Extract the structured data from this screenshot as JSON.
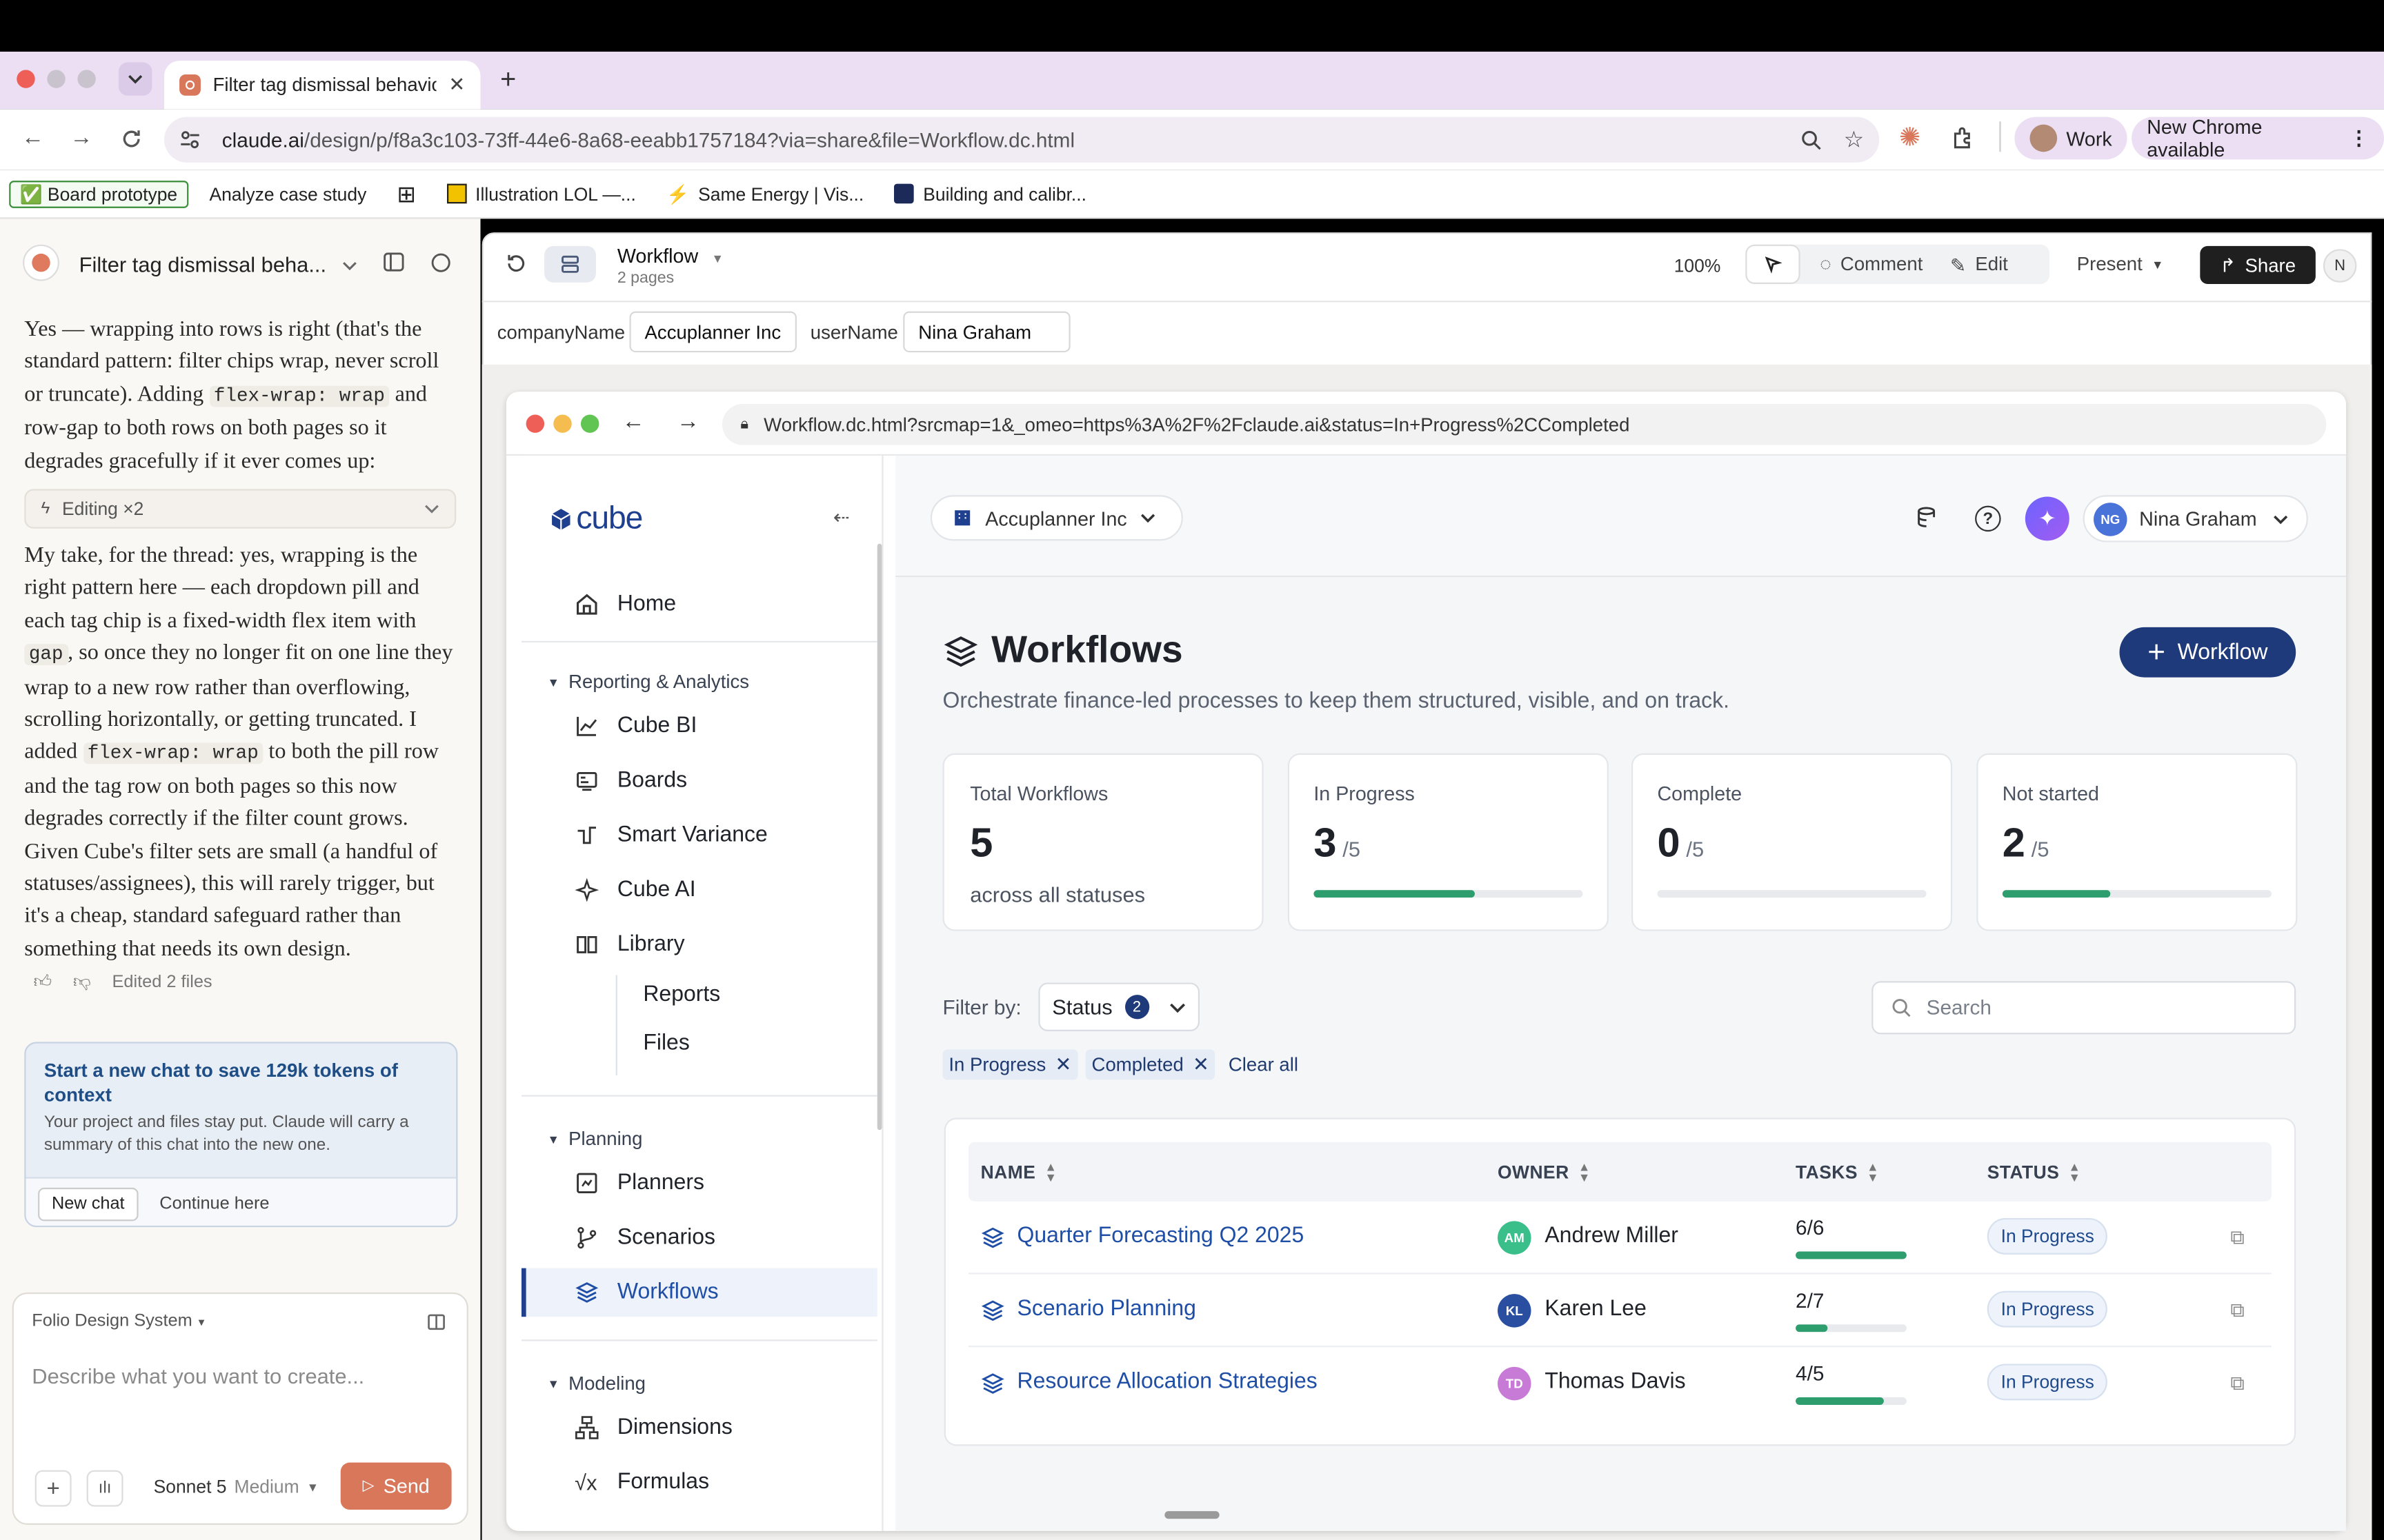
{
  "browser": {
    "tab_title": "Filter tag dismissal behavior",
    "url_host": "claude.ai",
    "url_path": "/design/p/f8a3c103-73ff-44e6-8a68-eeabb1757184?via=share&file=Workflow.dc.html",
    "profile_label": "Work",
    "update_label": "New Chrome available",
    "bookmarks": [
      "✅ Board prototype",
      "Analyze case study",
      "Illustration LOL —...",
      "Same Energy | Vis...",
      "Building and calibr..."
    ]
  },
  "chat": {
    "title": "Filter tag dismissal beha...",
    "para1_a": "Yes — wrapping into rows is right (that's the standard pattern: filter chips wrap, never scroll or truncate). Adding ",
    "para1_code": "flex-wrap: wrap",
    "para1_b": " and row-gap to both rows on both pages so it degrades gracefully if it ever comes up:",
    "editing_label": "Editing ×2",
    "para2_a": "My take, for the thread: yes, wrapping is the right pattern here — each dropdown pill and each tag chip is a fixed-width flex item with ",
    "para2_code1": "gap",
    "para2_b": ", so once they no longer fit on one line they wrap to a new row rather than overflowing, scrolling horizontally, or getting truncated. I added ",
    "para2_code2": "flex-wrap: wrap",
    "para2_c": " to both the pill row and the tag row on both pages so this now degrades correctly if the filter count grows. Given Cube's filter sets are small (a handful of statuses/assignees), this will rarely trigger, but it's a cheap, standard safeguard rather than something that needs its own design.",
    "edited_label": "Edited 2 files",
    "notice_title": "Start a new chat to save 129k tokens of context",
    "notice_body": "Your project and files stay put. Claude will carry a summary of this chat into the new one.",
    "new_chat_label": "New chat",
    "continue_label": "Continue here",
    "design_system_label": "Folio Design System",
    "composer_placeholder": "Describe what you want to create...",
    "model_label": "Sonnet 5",
    "effort_label": "Medium",
    "send_label": "Send"
  },
  "editor": {
    "file_title": "Workflow",
    "file_subtitle": "2 pages",
    "zoom": "100%",
    "comment_label": "Comment",
    "edit_label": "Edit",
    "present_label": "Present",
    "share_label": "Share",
    "user_initial": "N",
    "props": [
      {
        "label": "companyName",
        "value": "Accuplanner Inc"
      },
      {
        "label": "userName",
        "value": "Nina Graham"
      }
    ]
  },
  "preview": {
    "url": "Workflow.dc.html?srcmap=1&_omeo=https%3A%2F%2Fclaude.ai&status=In+Progress%2CCompleted",
    "logo_text": "cube",
    "company": "Accuplanner Inc",
    "user_initials": "NG",
    "user_name": "Nina Graham",
    "nav": {
      "home": "Home",
      "section_reporting": "Reporting & Analytics",
      "cube_bi": "Cube BI",
      "boards": "Boards",
      "smart_variance": "Smart Variance",
      "cube_ai": "Cube AI",
      "library": "Library",
      "reports": "Reports",
      "files": "Files",
      "section_planning": "Planning",
      "planners": "Planners",
      "scenarios": "Scenarios",
      "workflows": "Workflows",
      "section_modeling": "Modeling",
      "dimensions": "Dimensions",
      "formulas": "Formulas"
    },
    "page_title": "Workflows",
    "page_subtitle": "Orchestrate finance-led processes to keep them structured, visible, and on track.",
    "add_button": "Workflow",
    "stats": [
      {
        "label": "Total Workflows",
        "value": "5",
        "suffix": "",
        "note": "across all statuses",
        "progress": null
      },
      {
        "label": "In Progress",
        "value": "3",
        "suffix": "/5",
        "note": "",
        "progress": 0.6
      },
      {
        "label": "Complete",
        "value": "0",
        "suffix": "/5",
        "note": "",
        "progress": 0
      },
      {
        "label": "Not started",
        "value": "2",
        "suffix": "/5",
        "note": "",
        "progress": 0.4
      }
    ],
    "filter_label": "Filter by:",
    "filter_status": "Status",
    "filter_count": "2",
    "search_placeholder": "Search",
    "chips": [
      "In Progress",
      "Completed"
    ],
    "clear_all": "Clear all",
    "columns": [
      "NAME",
      "OWNER",
      "TASKS",
      "STATUS"
    ],
    "rows": [
      {
        "name": "Quarter Forecasting Q2 2025",
        "owner_initials": "AM",
        "owner": "Andrew Miller",
        "avatar_color": "#3bbf8a",
        "tasks": "6/6",
        "progress": 1.0,
        "status": "In Progress"
      },
      {
        "name": "Scenario Planning",
        "owner_initials": "KL",
        "owner": "Karen Lee",
        "avatar_color": "#2a4fa0",
        "tasks": "2/7",
        "progress": 0.2857,
        "status": "In Progress"
      },
      {
        "name": "Resource Allocation Strategies",
        "owner_initials": "TD",
        "owner": "Thomas Davis",
        "avatar_color": "#c77ad6",
        "tasks": "4/5",
        "progress": 0.8,
        "status": "In Progress"
      }
    ]
  }
}
